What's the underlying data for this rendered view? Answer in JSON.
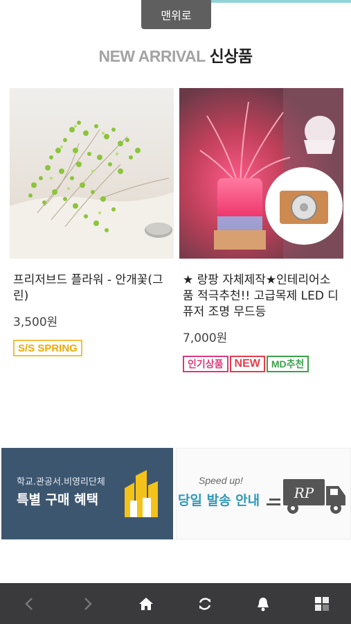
{
  "top_button": {
    "label": "맨위로"
  },
  "section": {
    "title_en": "NEW ARRIVAL",
    "title_ko": "신상품"
  },
  "products": [
    {
      "name": "프리저브드 플라워 - 안개꽃(그린)",
      "price": "3,500원",
      "badges": [
        "S/S SPRING"
      ],
      "image_icon": "baby-breath-flower-photo"
    },
    {
      "name": "★ 랑팡 자체제작★인테리어소품 적극추천!! 고급목제 LED 디퓨저 조명 무드등",
      "price": "7,000원",
      "badges": [
        "인기상품",
        "NEW",
        "MD추천"
      ],
      "image_icon": "led-diffuser-lamp-photo"
    }
  ],
  "banners": [
    {
      "small": "학교.관공서.비영리단체",
      "big": "특별 구매 혜택",
      "icon": "buildings-icon"
    },
    {
      "small": "Speed up!",
      "big": "당일 발송 안내",
      "icon": "delivery-truck-icon",
      "truck_logo": "RP"
    }
  ],
  "bottom_nav": {
    "items": [
      "back-icon",
      "forward-icon",
      "home-icon",
      "refresh-icon",
      "bell-icon",
      "grid-icon"
    ]
  },
  "colors": {
    "nav_bg": "#3a3a3c",
    "banner_left_bg": "#3d5670",
    "banner_right_accent": "#2f98b9"
  }
}
